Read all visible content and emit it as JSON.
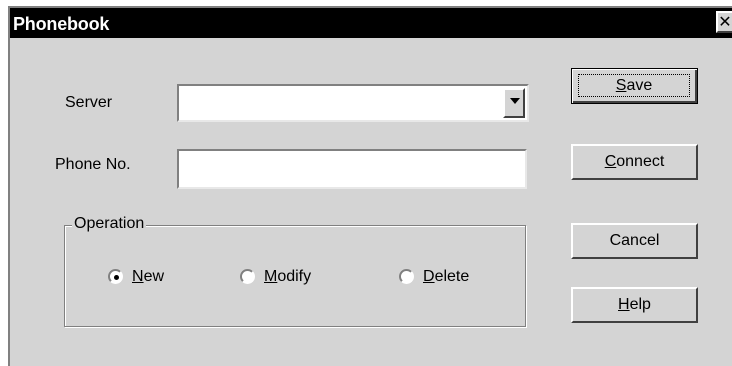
{
  "window": {
    "title": "Phonebook",
    "close_glyph": "✕"
  },
  "server": {
    "label": "Server",
    "value": ""
  },
  "phone": {
    "label": "Phone No.",
    "value": ""
  },
  "operation": {
    "label": "Operation",
    "options": [
      {
        "label": "New",
        "selected": true
      },
      {
        "label": "Modify",
        "selected": false
      },
      {
        "label": "Delete",
        "selected": false
      }
    ]
  },
  "buttons": {
    "save": "Save",
    "connect": "Connect",
    "cancel": "Cancel",
    "help": "Help"
  }
}
